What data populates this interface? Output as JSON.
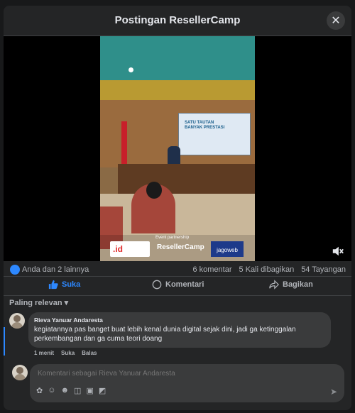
{
  "dialog": {
    "title": "Postingan ResellerCamp"
  },
  "video": {
    "screen_text": [
      "SATU TAUTAN",
      "BANYAK PRESTASI"
    ],
    "sponsor_label": "Event partnership",
    "sponsors": [
      ".id",
      "ResellerCamp",
      "jagoweb"
    ]
  },
  "stats": {
    "reactors": "Anda dan 2 lainnya",
    "comments": "6 komentar",
    "shares": "5 Kali dibagikan",
    "views": "54 Tayangan"
  },
  "actions": {
    "like": "Suka",
    "comment": "Komentari",
    "share": "Bagikan"
  },
  "sort": {
    "label": "Paling relevan"
  },
  "comment": {
    "author": "Rieva Yanuar Andaresta",
    "text": "kegiatannya pas banget buat lebih kenal dunia digital sejak dini, jadi ga ketinggalan perkembangan dan ga cuma teori doang",
    "time": "1 menit",
    "like": "Suka",
    "reply": "Balas"
  },
  "composer": {
    "placeholder": "Komentari sebagai Rieva Yanuar Andaresta"
  },
  "colors": {
    "accent": "#2d88ff",
    "bubble": "#3a3b3c",
    "background": "#242526"
  }
}
